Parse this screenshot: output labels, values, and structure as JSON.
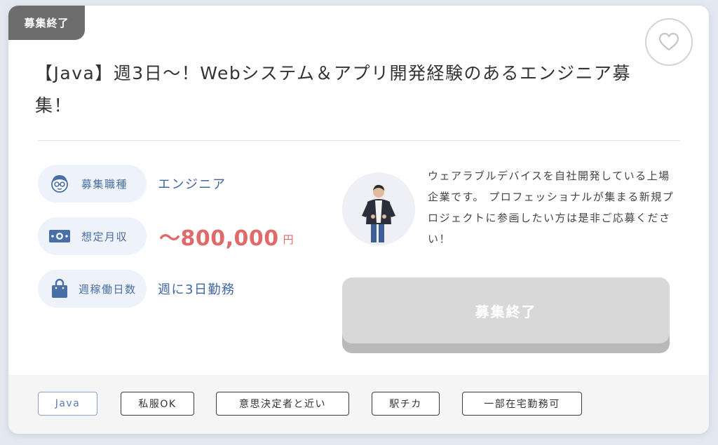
{
  "status_badge": "募集終了",
  "title": "【Java】週3日〜！Webシステム＆アプリ開発経験のあるエンジニア募集！",
  "info": {
    "job_type": {
      "label": "募集職種",
      "value": "エンジニア",
      "icon": "engineer-face-icon"
    },
    "salary": {
      "label": "想定月収",
      "value": "〜800,000",
      "unit": "円",
      "icon": "banknote-icon"
    },
    "days": {
      "label": "週稼働日数",
      "value": "週に3日勤務",
      "icon": "bag-icon"
    }
  },
  "description": "ウェアラブルデバイスを自社開発している上場企業です。 プロフェッショナルが集まる新規プロジェクトに参画したい方は是非ご応募ください！",
  "apply_button": "募集終了",
  "tags": [
    "Java",
    "私服OK",
    "意思決定者と近い",
    "駅チカ",
    "一部在宅勤務可"
  ],
  "colors": {
    "accent": "#3f66a6",
    "salary": "#e06a6a",
    "pill_bg": "#edf2fb",
    "badge_bg": "#6d6d6d",
    "button_disabled": "#d8d8d8"
  }
}
